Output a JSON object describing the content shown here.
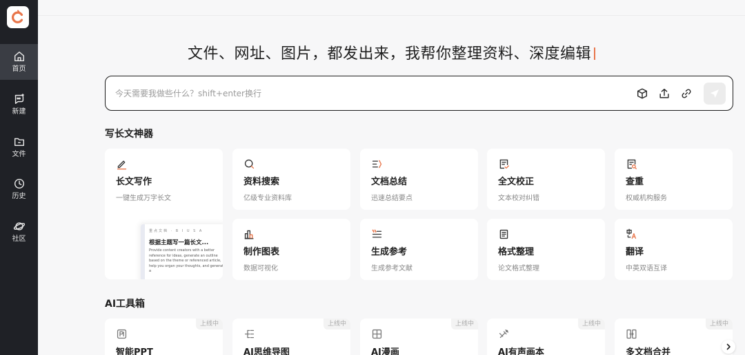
{
  "sidebar": {
    "items": [
      {
        "label": "首页",
        "icon": "home-icon",
        "active": true
      },
      {
        "label": "新建",
        "icon": "new-chat-icon"
      },
      {
        "label": "文件",
        "icon": "folder-icon"
      },
      {
        "label": "历史",
        "icon": "clock-icon"
      },
      {
        "label": "社区",
        "icon": "planet-icon"
      }
    ]
  },
  "headline": "文件、网址、图片，都发出来，我帮你整理资料、深度编辑",
  "prompt": {
    "placeholder": "今天需要我做些什么？shift+enter换行"
  },
  "sections": {
    "writing": {
      "title": "写长文神器",
      "cards": [
        {
          "title": "长文写作",
          "desc": "一键生成万字长文",
          "icon": "pen-icon"
        },
        {
          "title": "资料搜索",
          "desc": "亿级专业资料库",
          "icon": "search-icon"
        },
        {
          "title": "文档总结",
          "desc": "迅速总结要点",
          "icon": "summary-icon"
        },
        {
          "title": "全文校正",
          "desc": "文本校对纠错",
          "icon": "proofread-icon"
        },
        {
          "title": "查重",
          "desc": "权威机构服务",
          "icon": "plagiarism-check-icon"
        },
        {
          "title": "制作图表",
          "desc": "数据可视化",
          "icon": "chart-icon"
        },
        {
          "title": "生成参考",
          "desc": "生成参考文献",
          "icon": "reference-icon"
        },
        {
          "title": "格式整理",
          "desc": "论文格式整理",
          "icon": "format-icon"
        },
        {
          "title": "翻译",
          "desc": "中英双语互译",
          "icon": "translate-icon"
        }
      ],
      "preview": {
        "toolbar": "重点文档 · B I U S A",
        "title": "根据主题写一篇长文...",
        "body": "Provide content creators with a better reference for ideas, generate an outline based on the theme or referenced article, help you organ your thoughts, and generate a"
      }
    },
    "toolbox": {
      "title": "AI工具箱",
      "badge": "上线中",
      "cards": [
        {
          "title": "智能PPT",
          "icon": "ppt-icon"
        },
        {
          "title": "AI思维导图",
          "icon": "mindmap-icon"
        },
        {
          "title": "AI漫画",
          "icon": "comic-icon"
        },
        {
          "title": "AI有声画本",
          "icon": "audiobook-icon"
        },
        {
          "title": "多文档合并",
          "icon": "merge-icon"
        }
      ]
    }
  },
  "colors": {
    "accent": "#e8754a",
    "sidebar": "#1f2126",
    "background": "#f7f7f8"
  }
}
